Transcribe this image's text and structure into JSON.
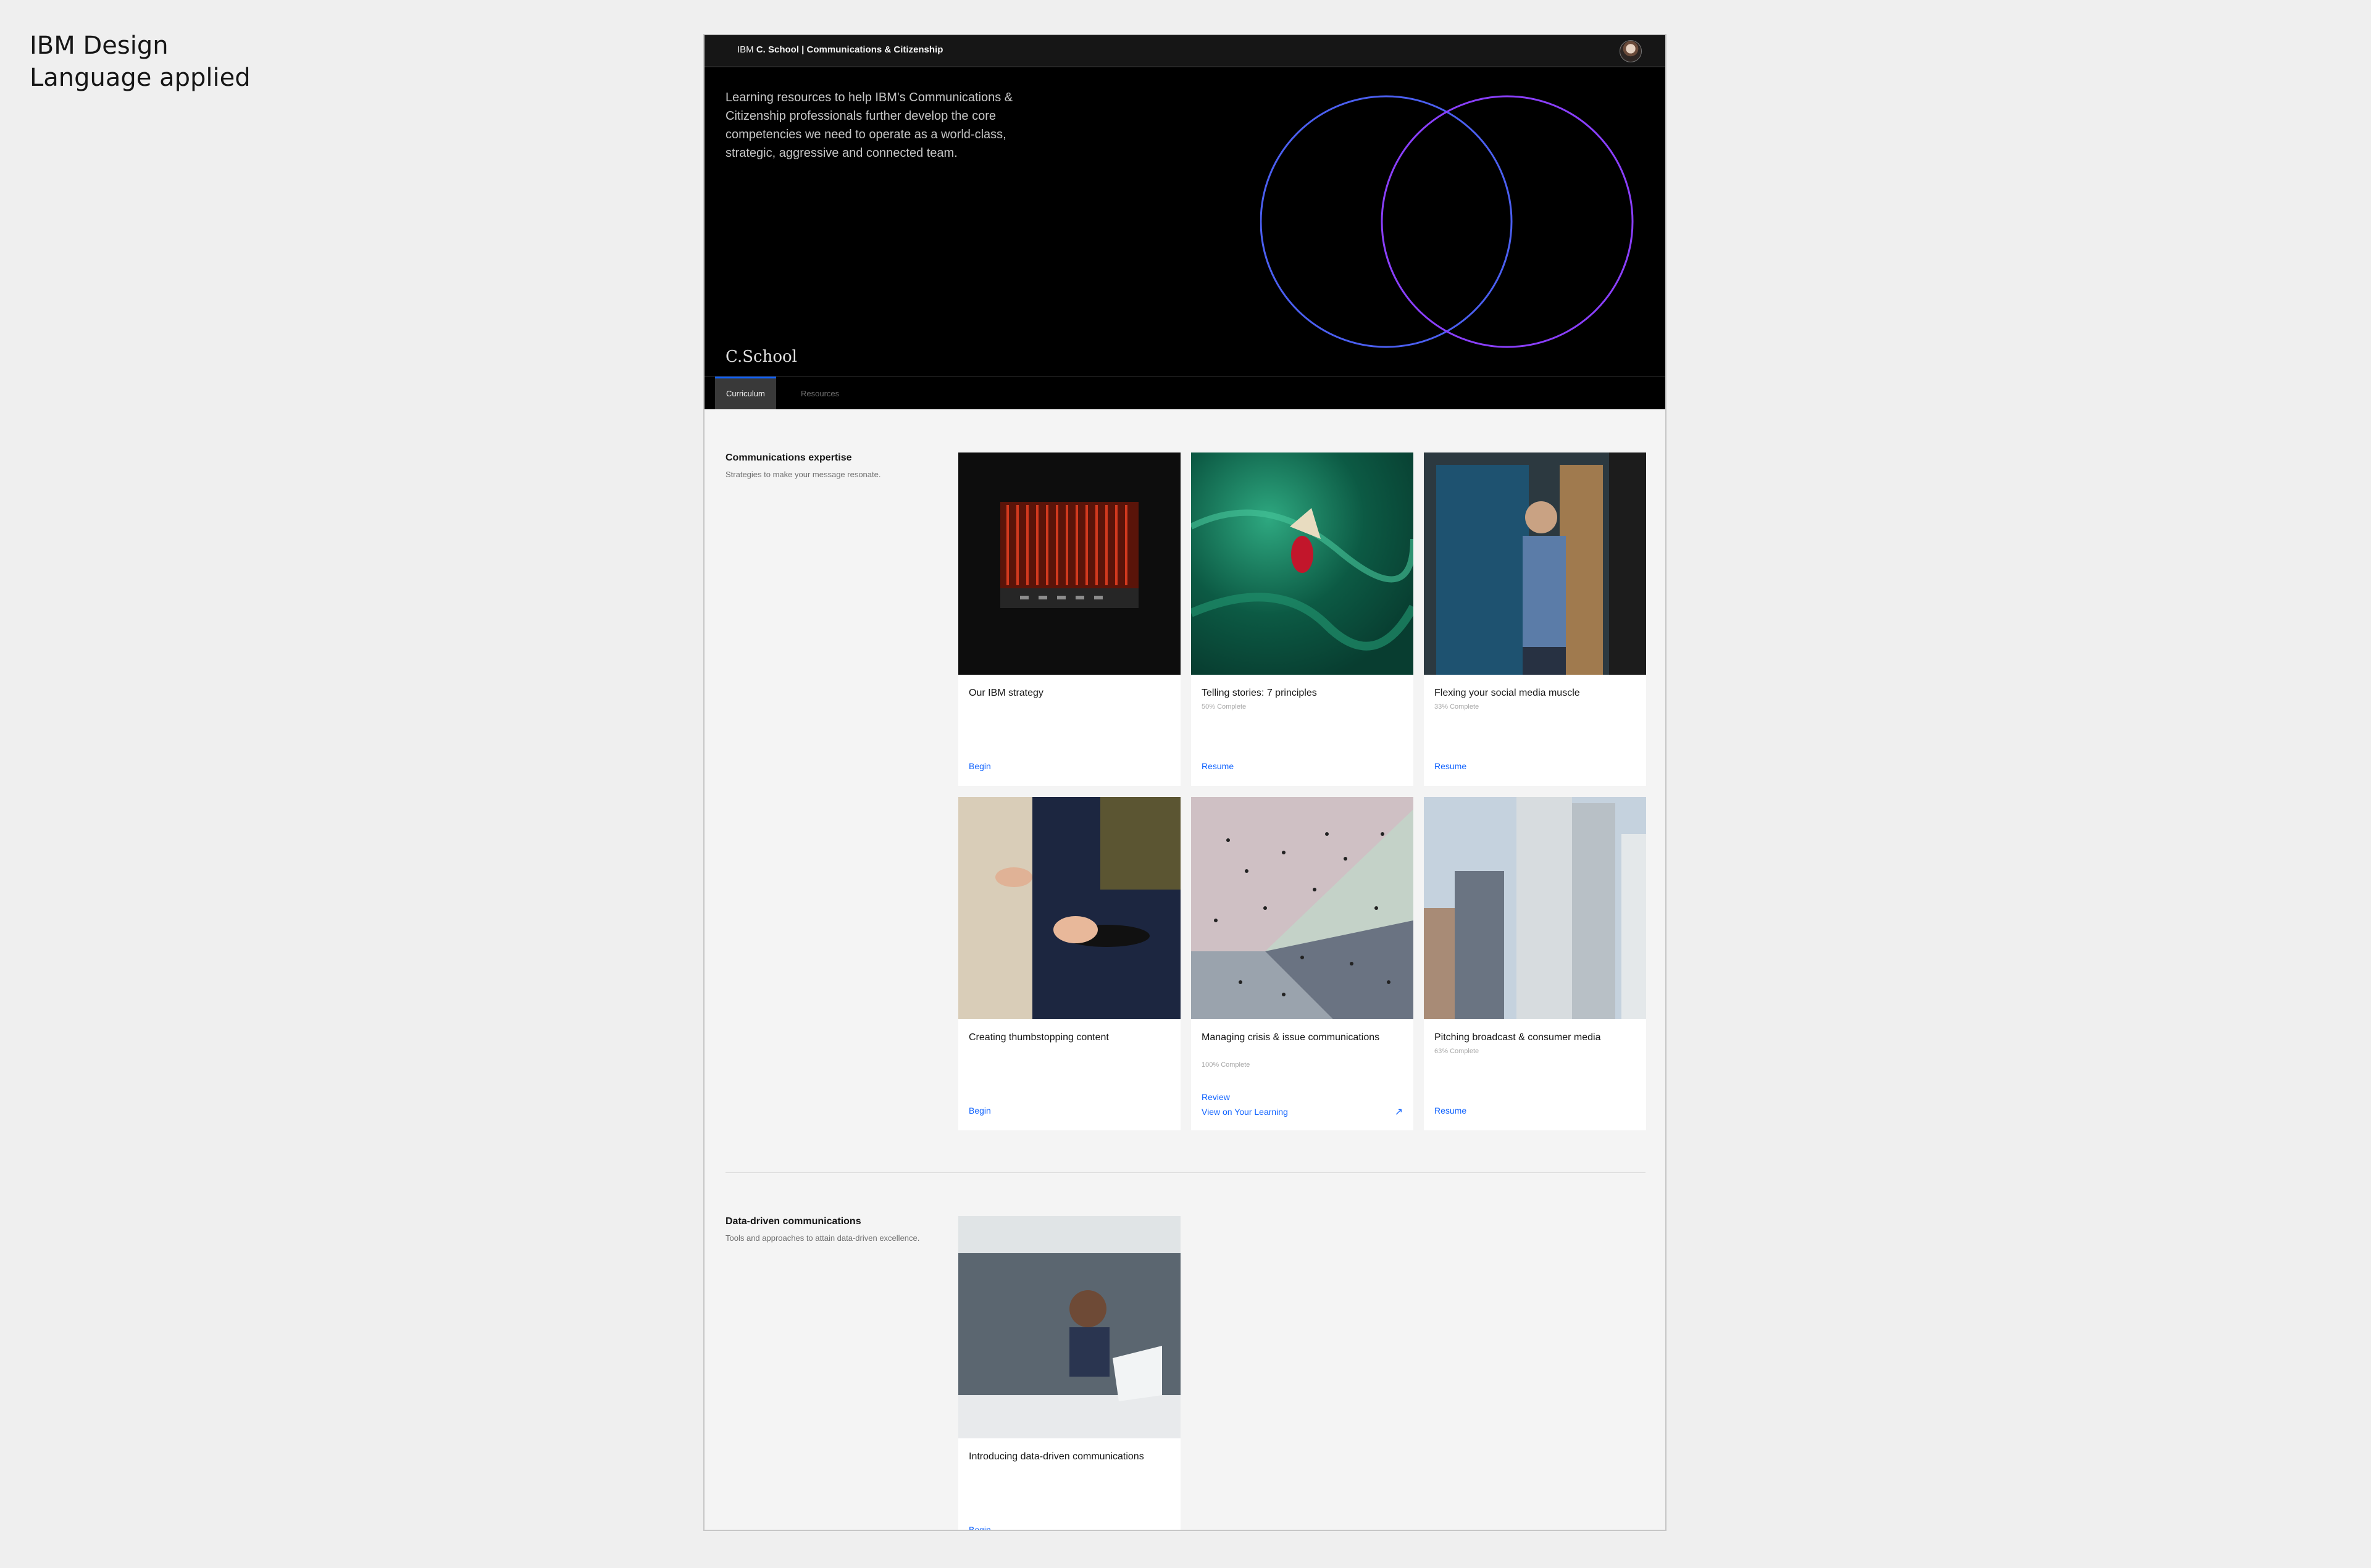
{
  "caption": "IBM Design Language applied",
  "header": {
    "brand_prefix": "IBM",
    "brand_title": "C. School | Communications & Citizenship",
    "avatar_icon": "user-avatar"
  },
  "hero": {
    "intro": "Learning resources to help IBM's Communications & Citizenship professionals further develop the core competencies we need to operate as a world-class, strategic, aggressive and connected team.",
    "logo": "C.School",
    "colors": {
      "circle_left": "#4b5ff0",
      "circle_right": "#8a3ffc"
    }
  },
  "tabs": [
    {
      "label": "Curriculum",
      "active": true
    },
    {
      "label": "Resources",
      "active": false
    }
  ],
  "sections": [
    {
      "title": "Communications expertise",
      "description": "Strategies to make your message resonate.",
      "cards": [
        {
          "title": "Our IBM strategy",
          "progress": "",
          "action": "Begin",
          "image": "server-rack"
        },
        {
          "title": "Telling stories: 7 principles",
          "progress": "50% Complete",
          "action": "Resume",
          "image": "green-fabric"
        },
        {
          "title": "Flexing your social media muscle",
          "progress": "33% Complete",
          "action": "Resume",
          "image": "man-with-phone"
        },
        {
          "title": "Creating thumbstopping content",
          "progress": "",
          "action": "Begin",
          "image": "hands-with-phone"
        },
        {
          "title": "Managing crisis & issue communications",
          "progress": "100% Complete",
          "action": "Review",
          "secondary_action": "View on Your Learning",
          "image": "aerial-crowd"
        },
        {
          "title": "Pitching broadcast & consumer media",
          "progress": "63% Complete",
          "action": "Resume",
          "image": "skyscrapers"
        }
      ]
    },
    {
      "title": "Data-driven communications",
      "description": "Tools and approaches to attain data-driven excellence.",
      "cards": [
        {
          "title": "Introducing data-driven communications",
          "progress": "",
          "action": "Begin",
          "image": "woman-with-laptop"
        }
      ]
    }
  ],
  "colors": {
    "link": "#0f62fe",
    "hero_bg": "#000000",
    "page_bg": "#f4f4f4"
  }
}
